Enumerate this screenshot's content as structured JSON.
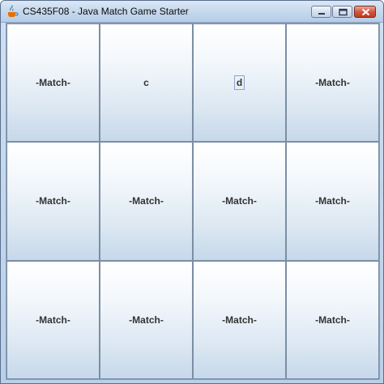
{
  "window": {
    "title": "CS435F08 - Java Match Game Starter",
    "icon": "java-icon"
  },
  "controls": [
    "minimize-icon",
    "maximize-icon",
    "close-icon"
  ],
  "colors": {
    "card_top": "#ffffff",
    "card_bottom": "#c6d8ea",
    "card_border": "#7b8ea3",
    "label": "#333333"
  },
  "cards": [
    {
      "label": "-Match-"
    },
    {
      "label": "c"
    },
    {
      "label": "d",
      "focused": true
    },
    {
      "label": "-Match-"
    },
    {
      "label": "-Match-"
    },
    {
      "label": "-Match-"
    },
    {
      "label": "-Match-"
    },
    {
      "label": "-Match-"
    },
    {
      "label": "-Match-"
    },
    {
      "label": "-Match-"
    },
    {
      "label": "-Match-"
    },
    {
      "label": "-Match-"
    }
  ]
}
